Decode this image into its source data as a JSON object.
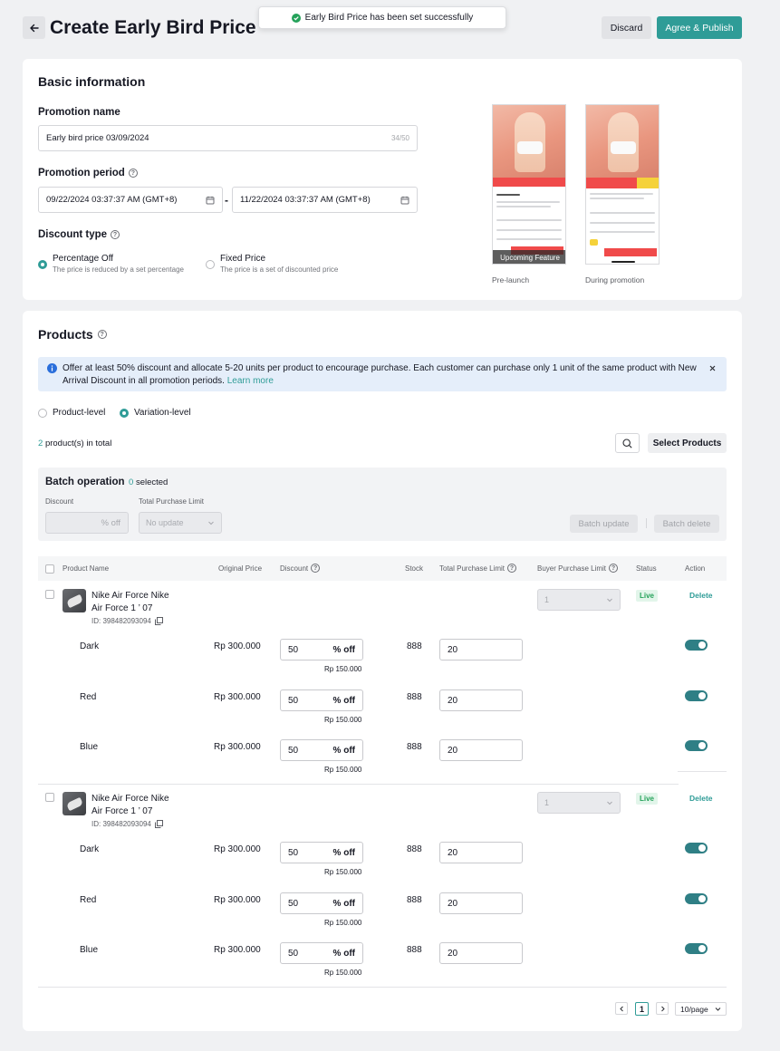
{
  "header": {
    "title": "Create Early Bird Price",
    "toast": "Early Bird Price has been set successfully",
    "discard_label": "Discard",
    "publish_label": "Agree & Publish"
  },
  "basic": {
    "title": "Basic information",
    "name_label": "Promotion name",
    "name_value": "Early bird price 03/09/2024",
    "name_counter": "34/50",
    "period_label": "Promotion period",
    "start_date": "09/22/2024 03:37:37 AM (GMT+8)",
    "period_separator": "-",
    "end_date": "11/22/2024 03:37:37 AM (GMT+8)",
    "discount_label": "Discount type",
    "options": [
      {
        "label": "Percentage Off",
        "desc": "The price is reduced by a set percentage",
        "selected": true
      },
      {
        "label": "Fixed Price",
        "desc": "The price is a set of discounted price",
        "selected": false
      }
    ],
    "preview": {
      "pre_label": "Pre-launch",
      "during_label": "During promotion",
      "upcoming_badge": "Upcoming Feature"
    }
  },
  "products": {
    "title": "Products",
    "notice": "Offer at least 50% discount and allocate 5-20 units per product to encourage purchase. Each customer can purchase only 1 unit of the same product with New Arrival Discount in all promotion periods.",
    "learn_more": "Learn more",
    "level_product": "Product-level",
    "level_variation": "Variation-level",
    "count": "2",
    "count_suffix": "product(s) in total",
    "select_products": "Select Products",
    "batch": {
      "title": "Batch operation",
      "selected_count": "0",
      "selected_suffix": "selected",
      "discount_label": "Discount",
      "discount_suffix": "% off",
      "limit_label": "Total Purchase Limit",
      "limit_placeholder": "No update",
      "update_label": "Batch update",
      "delete_label": "Batch delete"
    },
    "columns": {
      "name": "Product Name",
      "original_price": "Original Price",
      "discount": "Discount",
      "stock": "Stock",
      "total_limit": "Total Purchase Limit",
      "buyer_limit": "Buyer Purchase Limit",
      "status": "Status",
      "action": "Action"
    },
    "items": [
      {
        "name_line1": "Nike Air Force Nike",
        "name_line2": "Air Force 1 ’ 07",
        "id": "ID: 398482093094",
        "buyer_limit": "1",
        "status": "Live",
        "action": "Delete",
        "variations": [
          {
            "name": "Dark",
            "price": "Rp 300.000",
            "discount": "50",
            "discount_suffix": "% off",
            "final_price": "Rp 150.000",
            "stock": "888",
            "limit": "20",
            "enabled": true
          },
          {
            "name": "Red",
            "price": "Rp 300.000",
            "discount": "50",
            "discount_suffix": "% off",
            "final_price": "Rp 150.000",
            "stock": "888",
            "limit": "20",
            "enabled": true
          },
          {
            "name": "Blue",
            "price": "Rp 300.000",
            "discount": "50",
            "discount_suffix": "% off",
            "final_price": "Rp 150.000",
            "stock": "888",
            "limit": "20",
            "enabled": true
          }
        ]
      },
      {
        "name_line1": "Nike Air Force Nike",
        "name_line2": "Air Force 1 ’ 07",
        "id": "ID: 398482093094",
        "buyer_limit": "1",
        "status": "Live",
        "action": "Delete",
        "variations": [
          {
            "name": "Dark",
            "price": "Rp 300.000",
            "discount": "50",
            "discount_suffix": "% off",
            "final_price": "Rp 150.000",
            "stock": "888",
            "limit": "20",
            "enabled": true
          },
          {
            "name": "Red",
            "price": "Rp 300.000",
            "discount": "50",
            "discount_suffix": "% off",
            "final_price": "Rp 150.000",
            "stock": "888",
            "limit": "20",
            "enabled": true
          },
          {
            "name": "Blue",
            "price": "Rp 300.000",
            "discount": "50",
            "discount_suffix": "% off",
            "final_price": "Rp 150.000",
            "stock": "888",
            "limit": "20",
            "enabled": true
          }
        ]
      }
    ],
    "pagination": {
      "current": "1",
      "page_size": "10/page"
    }
  },
  "colors": {
    "accent": "#2f9c97",
    "live_text": "#25a25a",
    "toggle": "#2f7f85",
    "notice_bg": "#e5eefa",
    "info_icon": "#2a6edb"
  }
}
